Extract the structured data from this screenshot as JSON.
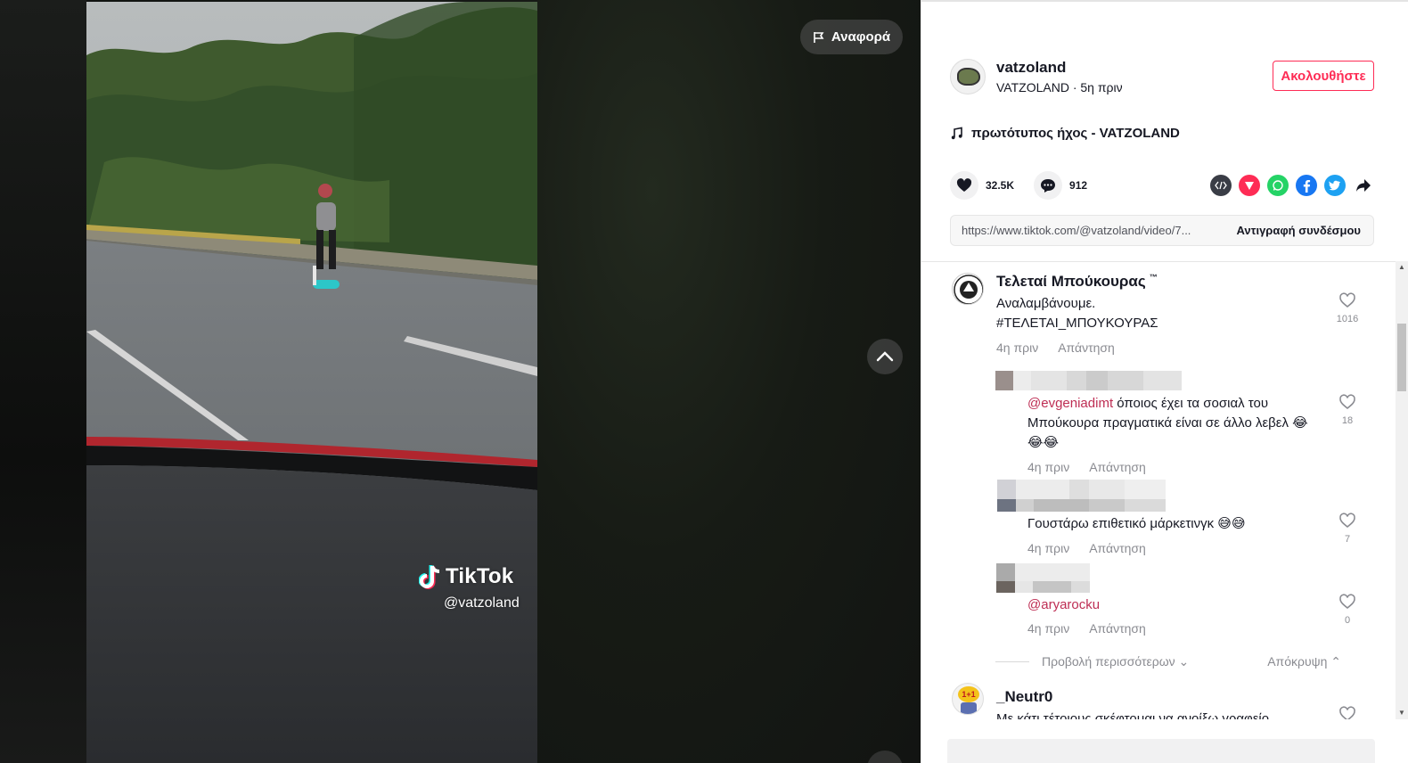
{
  "report_button": {
    "label": "Αναφορά"
  },
  "watermark": {
    "brand": "TikTok",
    "username": "@vatzoland"
  },
  "author": {
    "username": "vatzoland",
    "subtitle": "VATZOLAND · 5η πριν",
    "follow_label": "Ακολουθήστε"
  },
  "music": {
    "title": "πρωτότυπος ήχος - VATZOLAND"
  },
  "stats": {
    "likes": "32.5K",
    "comments": "912"
  },
  "share_icons": [
    "embed-icon",
    "send-to-friends-icon",
    "whatsapp-icon",
    "facebook-icon",
    "twitter-icon",
    "share-arrow-icon"
  ],
  "link": {
    "url": "https://www.tiktok.com/@vatzoland/video/7...",
    "copy_label": "Αντιγραφή συνδέσμου"
  },
  "comments": [
    {
      "name": "Τελεταί Μπούκουρας",
      "name_badge": "™",
      "line1": "Αναλαμβάνουμε.",
      "line2": "#ΤΕΛΕΤΑΙ_ΜΠΟΥΚΟΥΡΑΣ",
      "time": "4η πριν",
      "reply": "Απάντηση",
      "likes": "1016"
    },
    {
      "mention": "@evgeniadimt",
      "text_a": " όποιος έχει τα σοσιαλ του",
      "text_b": "Μπούκουρα πραγματικά είναι σε άλλο λεβελ 😂",
      "text_c": "😂😂",
      "time": "4η πριν",
      "reply": "Απάντηση",
      "likes": "18"
    },
    {
      "text": "Γουστάρω επιθετικό μάρκετινγκ 😅😅",
      "time": "4η πριν",
      "reply": "Απάντηση",
      "likes": "7"
    },
    {
      "mention": "@aryarocku",
      "time": "4η πριν",
      "reply": "Απάντηση",
      "likes": "0"
    },
    {
      "name": "_Neutr0",
      "text": "Με κάτι τέτοιους σκέφτομαι να ανοίξω γραφείο",
      "avatar_text": "1+1"
    }
  ],
  "more": {
    "view_more": "Προβολή περισσότερων",
    "hide": "Απόκρυψη"
  },
  "colors": {
    "accent": "#fe2c55",
    "mention": "#be2e54",
    "muted": "#8a8b91"
  }
}
